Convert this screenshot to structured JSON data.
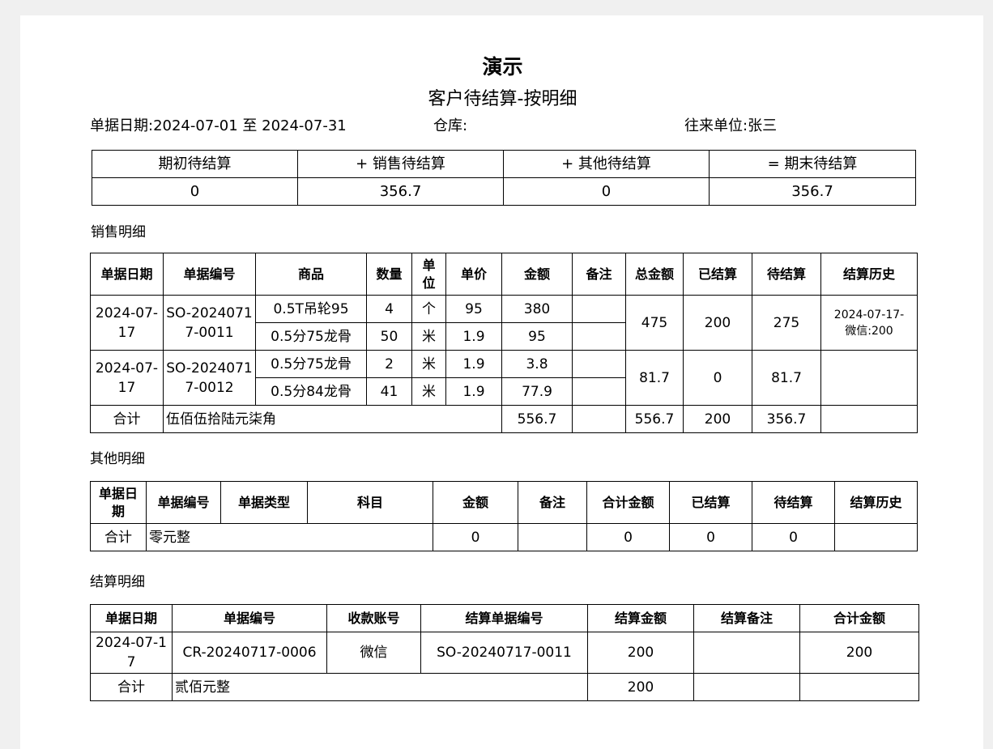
{
  "header": {
    "title": "演示",
    "subtitle": "客户待结算-按明细",
    "date_label": "单据日期:",
    "date_range": "2024-07-01 至 2024-07-31",
    "warehouse_label": "仓库:",
    "warehouse_value": "",
    "partner_label": "往来单位:",
    "partner_value": "张三"
  },
  "summary": {
    "headers": [
      "期初待结算",
      "+ 销售待结算",
      "+ 其他待结算",
      "= 期末待结算"
    ],
    "values": [
      "0",
      "356.7",
      "0",
      "356.7"
    ]
  },
  "sales": {
    "section_title": "销售明细",
    "headers": [
      "单据日期",
      "单据编号",
      "商品",
      "数量",
      "单\n位",
      "单价",
      "金额",
      "备注",
      "总金额",
      "已结算",
      "待结算",
      "结算历史"
    ],
    "orders": [
      {
        "date": "2024-07-\n17",
        "number": "SO-2024071\n7-0011",
        "items": [
          {
            "product": "0.5T吊轮95",
            "qty": "4",
            "unit": "个",
            "price": "95",
            "amount": "380",
            "note": ""
          },
          {
            "product": "0.5分75龙骨",
            "qty": "50",
            "unit": "米",
            "price": "1.9",
            "amount": "95",
            "note": ""
          }
        ],
        "total": "475",
        "settled": "200",
        "pending": "275",
        "history": "2024-07-17-\n微信:200"
      },
      {
        "date": "2024-07-\n17",
        "number": "SO-2024071\n7-0012",
        "items": [
          {
            "product": "0.5分75龙骨",
            "qty": "2",
            "unit": "米",
            "price": "1.9",
            "amount": "3.8",
            "note": ""
          },
          {
            "product": "0.5分84龙骨",
            "qty": "41",
            "unit": "米",
            "price": "1.9",
            "amount": "77.9",
            "note": ""
          }
        ],
        "total": "81.7",
        "settled": "0",
        "pending": "81.7",
        "history": ""
      }
    ],
    "totals": {
      "label": "合计",
      "amount_in_words": "伍佰伍拾陆元柒角",
      "amount": "556.7",
      "note": "",
      "total": "556.7",
      "settled": "200",
      "pending": "356.7",
      "history": ""
    }
  },
  "other": {
    "section_title": "其他明细",
    "headers": [
      "单据日\n期",
      "单据编号",
      "单据类型",
      "科目",
      "金额",
      "备注",
      "合计金额",
      "已结算",
      "待结算",
      "结算历史"
    ],
    "totals": {
      "label": "合计",
      "amount_in_words": "零元整",
      "amount": "0",
      "note": "",
      "total": "0",
      "settled": "0",
      "pending": "0",
      "history": ""
    }
  },
  "settlement": {
    "section_title": "结算明细",
    "headers": [
      "单据日期",
      "单据编号",
      "收款账号",
      "结算单据编号",
      "结算金额",
      "结算备注",
      "合计金额"
    ],
    "rows": [
      {
        "date": "2024-07-1\n7",
        "number": "CR-20240717-0006",
        "account": "微信",
        "settle_number": "SO-20240717-0011",
        "amount": "200",
        "note": "",
        "total": "200"
      }
    ],
    "totals": {
      "label": "合计",
      "amount_in_words": "贰佰元整",
      "amount": "200",
      "note": "",
      "total": ""
    }
  }
}
